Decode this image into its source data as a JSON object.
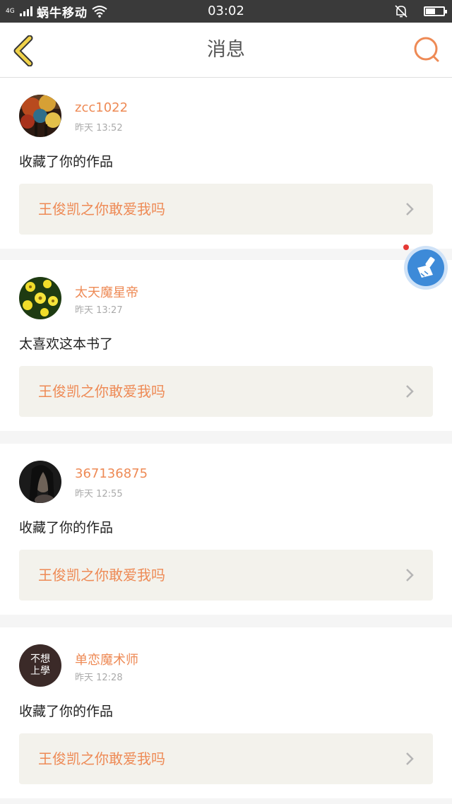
{
  "status_bar": {
    "network_type": "4G",
    "carrier": "蜗牛移动",
    "time": "03:02",
    "battery_percent": 55,
    "icons": [
      "signal-icon",
      "wifi-icon",
      "bell-muted-icon",
      "battery-icon"
    ]
  },
  "header": {
    "title": "消息",
    "back_icon": "chevron-left-icon",
    "search_icon": "search-icon"
  },
  "colors": {
    "accent": "#ee8a55",
    "back_arrow": "#f0d24a",
    "card_bg": "#f3f2ec",
    "float_button": "#3d8ad8"
  },
  "messages": [
    {
      "username": "zcc1022",
      "time": "昨天 13:52",
      "text": "收藏了你的作品",
      "work_title": "王俊凯之你敢爱我吗"
    },
    {
      "username": "太天魔星帝",
      "time": "昨天 13:27",
      "text": "太喜欢这本书了",
      "work_title": "王俊凯之你敢爱我吗"
    },
    {
      "username": "367136875",
      "time": "昨天 12:55",
      "text": "收藏了你的作品",
      "work_title": "王俊凯之你敢爱我吗"
    },
    {
      "username": "单恋魔术师",
      "avatar_text": [
        "不想",
        "上學"
      ],
      "time": "昨天 12:28",
      "text": "收藏了你的作品",
      "work_title": "王俊凯之你敢爱我吗"
    }
  ],
  "floating_button": {
    "icon": "broom-icon",
    "has_notification": true
  }
}
